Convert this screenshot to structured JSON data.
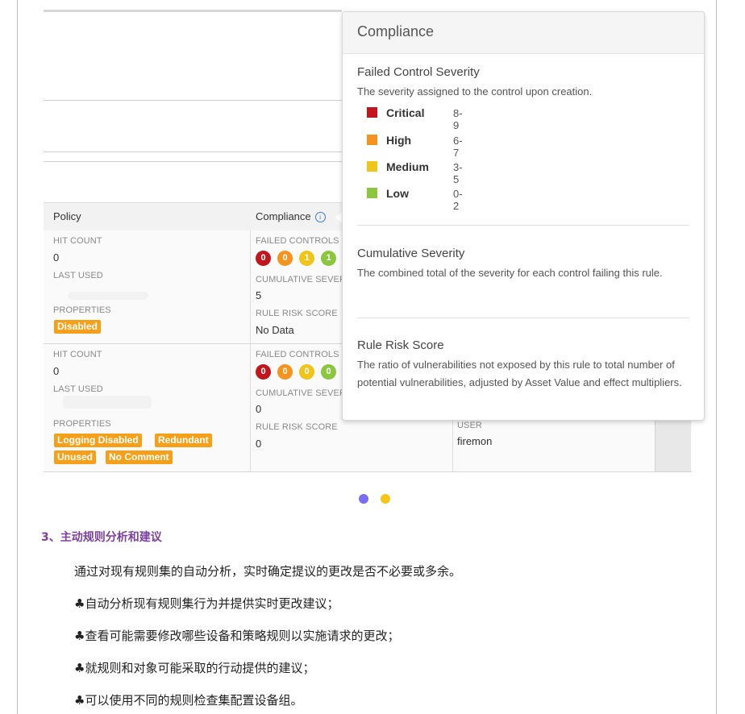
{
  "table": {
    "headers": {
      "policy": "Policy",
      "compliance": "Compliance"
    },
    "rows": [
      {
        "hit_count_label": "HIT COUNT",
        "hit_count": "0",
        "last_used_label": "LAST USED",
        "properties_label": "PROPERTIES",
        "tags": [
          "Disabled"
        ],
        "failed_controls_label": "FAILED CONTROLS",
        "failed_controls": [
          "0",
          "0",
          "1",
          "1"
        ],
        "cumulative_label": "CUMULATIVE SEVERI",
        "cumulative": "5",
        "risk_label": "RULE RISK SCORE",
        "risk": "No Data"
      },
      {
        "hit_count_label": "HIT COUNT",
        "hit_count": "0",
        "last_used_label": "LAST USED",
        "properties_label": "PROPERTIES",
        "tags": [
          "Logging Disabled",
          "Redundant",
          "Unused",
          "No Comment"
        ],
        "failed_controls_label": "FAILED CONTROLS",
        "failed_controls": [
          "0",
          "0",
          "0",
          "0"
        ],
        "cumulative_label": "CUMULATIVE SEVERI",
        "cumulative": "0",
        "risk_label": "RULE RISK SCORE",
        "risk": "0",
        "user_label": "USER",
        "user": "firemon"
      }
    ]
  },
  "popover": {
    "title": "Compliance",
    "failed": {
      "title": "Failed Control Severity",
      "desc": "The severity assigned to the control upon creation.",
      "levels": [
        {
          "name": "Critical",
          "range": "8-9",
          "color": "#c3161c"
        },
        {
          "name": "High",
          "range": "6-7",
          "color": "#f6931e"
        },
        {
          "name": "Medium",
          "range": "3-5",
          "color": "#f0c419"
        },
        {
          "name": "Low",
          "range": "0-2",
          "color": "#8cc63f"
        }
      ]
    },
    "cumulative": {
      "title": "Cumulative Severity",
      "desc": "The combined total of the severity for each control failing this rule."
    },
    "risk": {
      "title": "Rule Risk Score",
      "desc": "The ratio of vulnerabilities not exposed by this rule to total number of potential vulnerabilities, adjusted by Asset Value and effect multipliers."
    }
  },
  "carousel": {
    "active_color": "#7b6cf6",
    "inactive_color": "#f5c518"
  },
  "article": {
    "heading": "3、主动规则分析和建议",
    "intro": "通过对现有规则集的自动分析，实时确定提议的更改是否不必要或多余。",
    "bullets": [
      "♣自动分析现有规则集行为并提供实时更改建议；",
      "♣查看可能需要修改哪些设备和策略规则以实施请求的更改；",
      "♣就规则和对象可能采取的行动提供的建议；",
      "♣可以使用不同的规则检查集配置设备组。"
    ]
  }
}
